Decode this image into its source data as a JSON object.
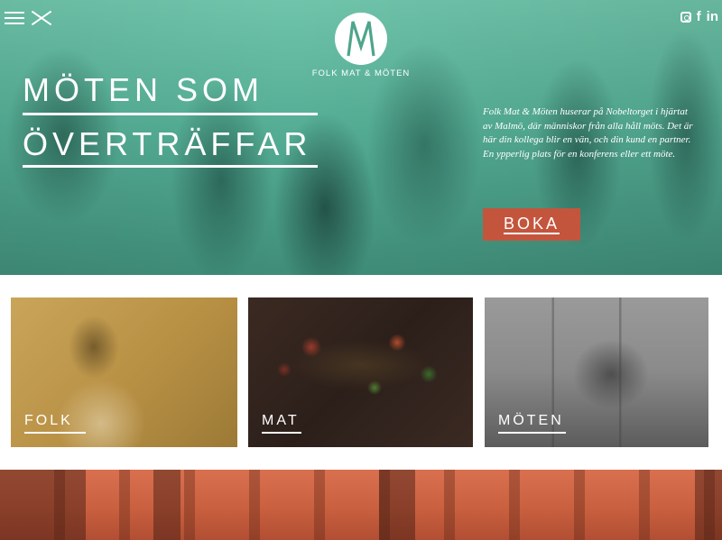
{
  "brand": {
    "name": "FOLK MAT & MÖTEN",
    "logo_letter": "M"
  },
  "social": {
    "instagram": "instagram-icon",
    "facebook": "f",
    "linkedin": "in"
  },
  "hero": {
    "headline_line1": "MÖTEN SOM",
    "headline_line2": "ÖVERTRÄFFAR",
    "intro": "Folk Mat & Möten huserar på Nobeltorget i hjärtat av Malmö, där människor från alla håll möts. Det är här din kollega blir en vän, och din kund en partner. En ypperlig plats för en konferens eller ett möte.",
    "cta_label": "BOKA",
    "accent_color": "#5bb39a",
    "cta_color": "#c4553d"
  },
  "tiles": [
    {
      "label": "FOLK"
    },
    {
      "label": "MAT"
    },
    {
      "label": "MÖTEN"
    }
  ],
  "banner": {
    "color": "#c9603f"
  }
}
